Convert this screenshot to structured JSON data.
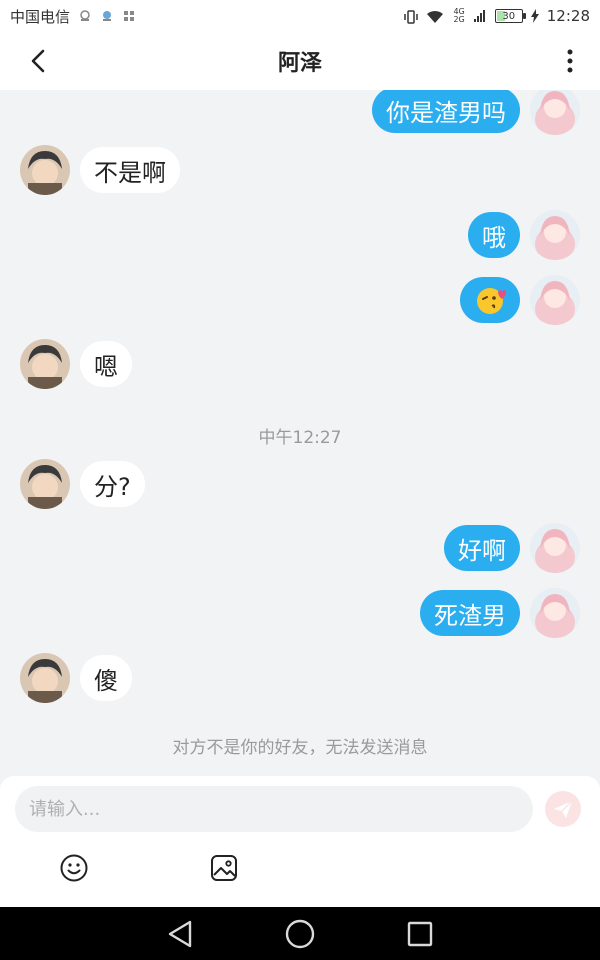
{
  "status_bar": {
    "carrier": "中国电信",
    "network_badge_top": "4G",
    "network_badge_bottom": "2G",
    "battery_level": "30",
    "time": "12:28"
  },
  "header": {
    "title": "阿泽"
  },
  "messages": [
    {
      "side": "right",
      "text": "你是渣男吗"
    },
    {
      "side": "left",
      "text": "不是啊"
    },
    {
      "side": "right",
      "text": "哦"
    },
    {
      "side": "right",
      "text": "😘"
    },
    {
      "side": "left",
      "text": "嗯"
    },
    {
      "side": "left",
      "text": "分?"
    },
    {
      "side": "right",
      "text": "好啊"
    },
    {
      "side": "right",
      "text": "死渣男"
    },
    {
      "side": "left",
      "text": "傻"
    }
  ],
  "timestamp": "中午12:27",
  "system_notice": "对方不是你的好友，无法发送消息",
  "input": {
    "placeholder": "请输入...",
    "value": ""
  },
  "colors": {
    "accent": "#2aaef0",
    "send_button_bg": "#fbe3e3",
    "send_icon": "#ffffff",
    "background": "#f2f3f5"
  }
}
